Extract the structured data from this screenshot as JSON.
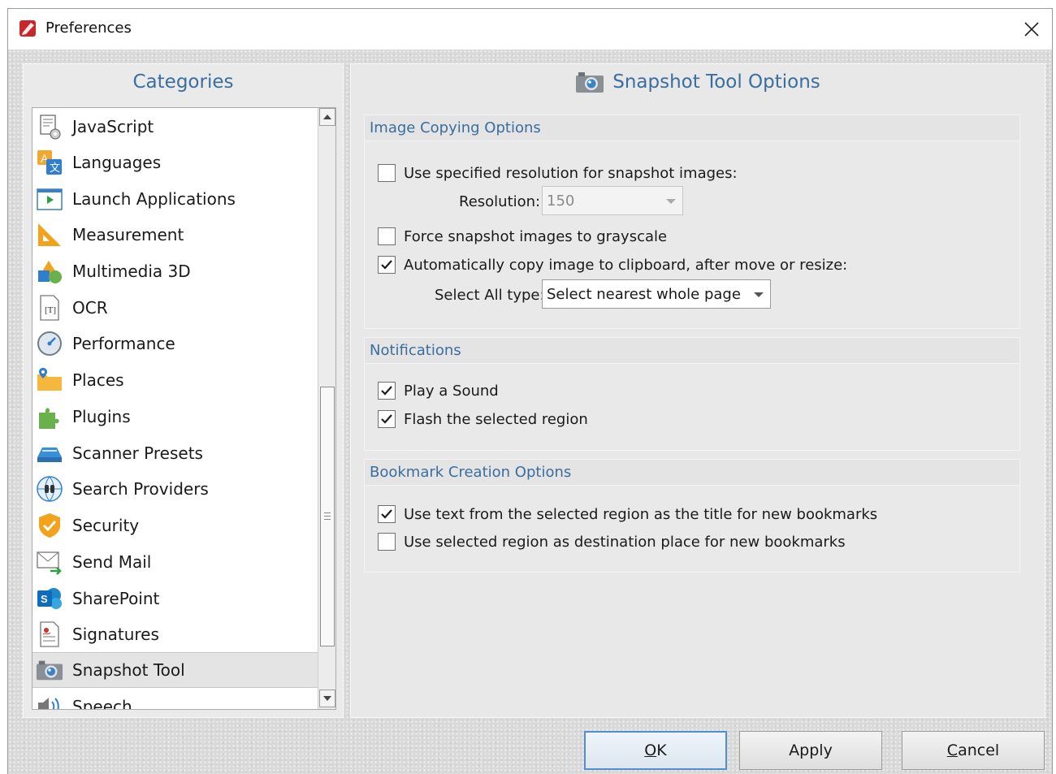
{
  "window": {
    "title": "Preferences"
  },
  "categories": {
    "header": "Categories",
    "items": [
      {
        "label": "JavaScript",
        "icon": "script-gear-icon"
      },
      {
        "label": "Languages",
        "icon": "translate-icon"
      },
      {
        "label": "Launch Applications",
        "icon": "play-window-icon"
      },
      {
        "label": "Measurement",
        "icon": "ruler-triangle-icon"
      },
      {
        "label": "Multimedia 3D",
        "icon": "shapes-3d-icon"
      },
      {
        "label": "OCR",
        "icon": "ocr-document-icon"
      },
      {
        "label": "Performance",
        "icon": "speedometer-icon"
      },
      {
        "label": "Places",
        "icon": "folder-location-icon"
      },
      {
        "label": "Plugins",
        "icon": "puzzle-icon"
      },
      {
        "label": "Scanner Presets",
        "icon": "scanner-icon"
      },
      {
        "label": "Search Providers",
        "icon": "globe-binoculars-icon"
      },
      {
        "label": "Security",
        "icon": "shield-check-icon"
      },
      {
        "label": "Send Mail",
        "icon": "mail-send-icon"
      },
      {
        "label": "SharePoint",
        "icon": "sharepoint-icon"
      },
      {
        "label": "Signatures",
        "icon": "signature-document-icon"
      },
      {
        "label": "Snapshot Tool",
        "icon": "camera-icon",
        "selected": true
      },
      {
        "label": "Speech",
        "icon": "speaker-icon"
      }
    ]
  },
  "options": {
    "header": "Snapshot Tool Options",
    "image_copying": {
      "title": "Image Copying Options",
      "use_resolution": {
        "label": "Use specified resolution for snapshot images:",
        "checked": false
      },
      "resolution_label": "Resolution:",
      "resolution_value": "150",
      "grayscale": {
        "label": "Force snapshot images to grayscale",
        "checked": false
      },
      "auto_copy": {
        "label": "Automatically copy image to clipboard, after move or resize:",
        "checked": true
      },
      "select_all_label": "Select All type:",
      "select_all_value": "Select nearest whole page"
    },
    "notifications": {
      "title": "Notifications",
      "play_sound": {
        "label": "Play a Sound",
        "checked": true
      },
      "flash_region": {
        "label": "Flash the selected region",
        "checked": true
      }
    },
    "bookmarks": {
      "title": "Bookmark Creation Options",
      "use_text": {
        "label": "Use text from the selected region as the title for new bookmarks",
        "checked": true
      },
      "use_region": {
        "label": "Use selected region as destination place for new bookmarks",
        "checked": false
      }
    }
  },
  "buttons": {
    "ok": {
      "underline": "O",
      "rest": "K"
    },
    "apply": "Apply",
    "cancel": {
      "underline": "C",
      "rest": "ancel"
    }
  },
  "colors": {
    "accent_text": "#3a6e9e",
    "default_button_border": "#4f8fd0",
    "check": "#1d1d1d"
  }
}
